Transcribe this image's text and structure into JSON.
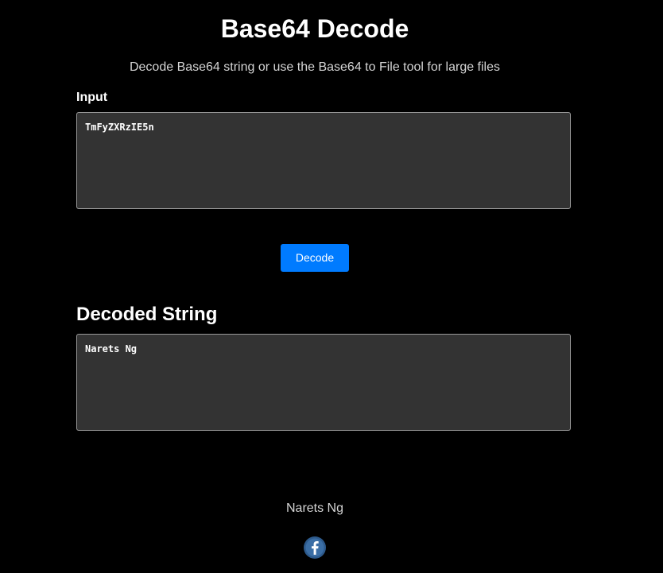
{
  "header": {
    "title": "Base64 Decode",
    "subtitle": "Decode Base64 string or use the Base64 to File tool for large files"
  },
  "input": {
    "label": "Input",
    "value": "TmFyZXRzIE5n"
  },
  "decode_button": {
    "label": "Decode",
    "color": "#007bff"
  },
  "output": {
    "heading": "Decoded String",
    "value": "Narets Ng"
  },
  "footer": {
    "name": "Narets Ng",
    "social_icon": "facebook-icon",
    "social_icon_color": "#2d5a8c"
  }
}
